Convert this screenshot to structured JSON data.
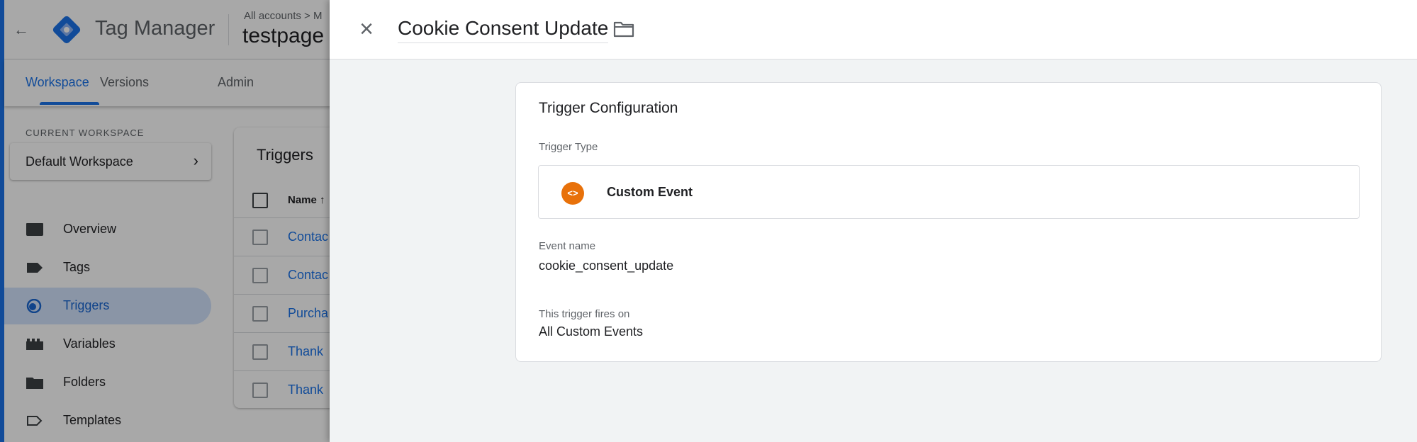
{
  "app": {
    "product_name": "Tag Manager",
    "breadcrumb": "All accounts > M",
    "container_name": "testpage"
  },
  "nav": {
    "tabs": [
      {
        "label": "Workspace",
        "active": true
      },
      {
        "label": "Versions",
        "active": false
      },
      {
        "label": "Admin",
        "active": false
      }
    ]
  },
  "sidebar": {
    "current_workspace_label": "CURRENT WORKSPACE",
    "workspace_name": "Default Workspace",
    "items": [
      {
        "label": "Overview",
        "icon": "overview-icon"
      },
      {
        "label": "Tags",
        "icon": "tag-icon"
      },
      {
        "label": "Triggers",
        "icon": "trigger-icon",
        "active": true
      },
      {
        "label": "Variables",
        "icon": "variables-icon"
      },
      {
        "label": "Folders",
        "icon": "folder-icon"
      },
      {
        "label": "Templates",
        "icon": "template-icon"
      }
    ]
  },
  "triggers_list": {
    "title": "Triggers",
    "column_name": "Name",
    "rows": [
      "Contac",
      "Contac",
      "Purcha",
      "Thank",
      "Thank"
    ]
  },
  "sheet": {
    "title": "Cookie Consent Update",
    "config": {
      "title": "Trigger Configuration",
      "trigger_type_label": "Trigger Type",
      "trigger_type": "Custom Event",
      "trigger_type_icon": "<>",
      "event_name_label": "Event name",
      "event_name": "cookie_consent_update",
      "fires_on_label": "This trigger fires on",
      "fires_on": "All Custom Events"
    }
  },
  "colors": {
    "accent": "#1a73e8",
    "custom_event_icon": "#e8710a",
    "active_nav_bg": "#d2e3fc"
  }
}
